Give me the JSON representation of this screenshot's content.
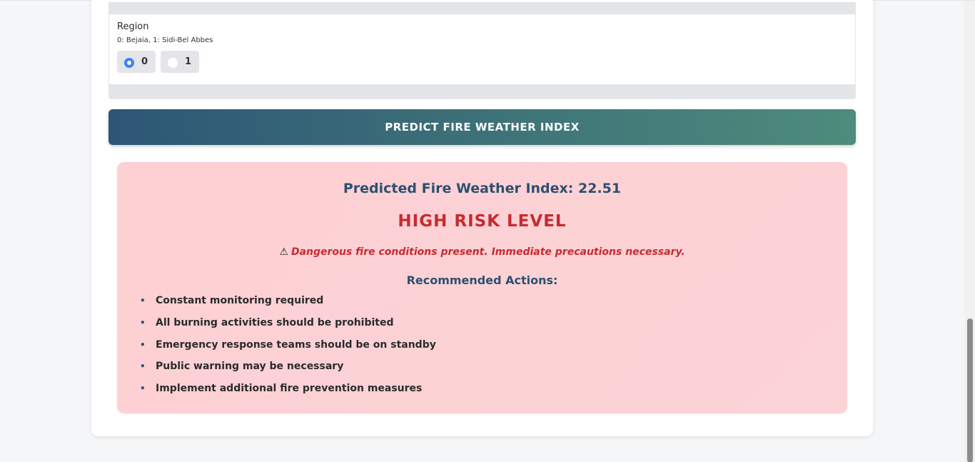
{
  "region": {
    "label": "Region",
    "hint": "0: Bejaia, 1: Sidi-Bel Abbes",
    "options": [
      {
        "label": "0",
        "selected": true
      },
      {
        "label": "1",
        "selected": false
      }
    ]
  },
  "predict_button": {
    "label": "PREDICT FIRE WEATHER INDEX"
  },
  "result": {
    "prediction_text": "Predicted Fire Weather Index: 22.51",
    "risk_level": "HIGH RISK LEVEL",
    "warning_icon": "⚠",
    "warning_text": "Dangerous fire conditions present. Immediate precautions necessary.",
    "recommended_title": "Recommended Actions:",
    "actions": [
      "Constant monitoring required",
      "All burning activities should be prohibited",
      "Emergency response teams should be on standby",
      "Public warning may be necessary",
      "Implement additional fire prevention measures"
    ]
  },
  "colors": {
    "accent_blue": "#2c5070",
    "risk_red": "#c62b31",
    "radio_selected": "#3b82f6",
    "result_bg": "#fdd0d4"
  }
}
